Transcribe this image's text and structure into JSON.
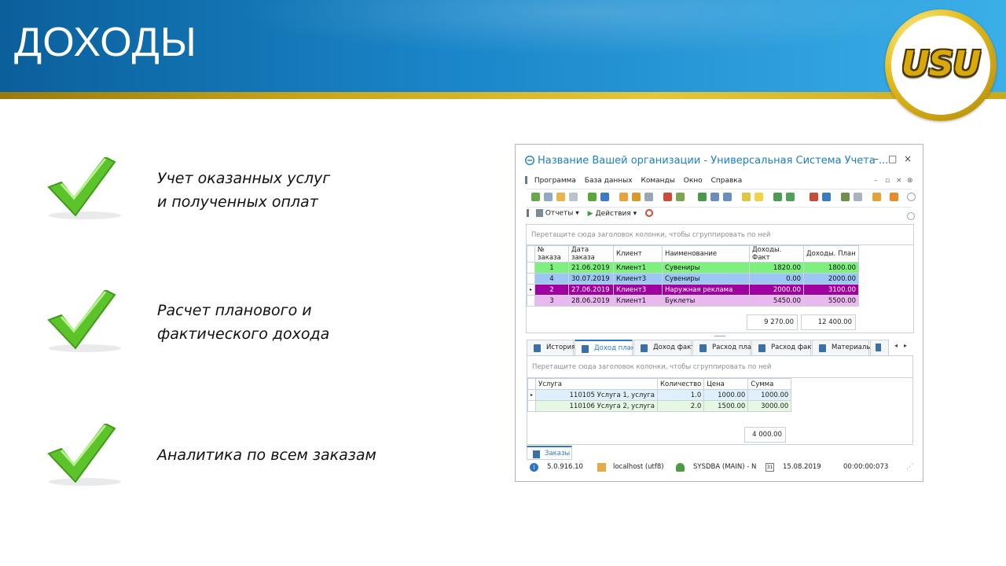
{
  "slide": {
    "title": "ДОХОДЫ",
    "logo_text": "USU",
    "colors": {
      "header_blue": "#1a86c9",
      "gold": "#c7a41c",
      "check_green": "#5cc42a"
    }
  },
  "features": [
    {
      "icon": "checkmark-icon",
      "lines": [
        "Учет оказанных услуг",
        "и полученных оплат"
      ]
    },
    {
      "icon": "checkmark-icon",
      "lines": [
        "Расчет планового и",
        "фактического дохода"
      ]
    },
    {
      "icon": "checkmark-icon",
      "lines": [
        "Аналитика по всем заказам"
      ]
    }
  ],
  "app": {
    "title": "Название Вашей организации - Универсальная Система Учета ...",
    "window_buttons": {
      "minimize": "–",
      "restore": "□",
      "close": "×"
    },
    "menu": [
      "Программа",
      "База данных",
      "Команды",
      "Окно",
      "Справка"
    ],
    "toolbar2": {
      "reports": "Отчеты ▾",
      "actions": "Действия ▾"
    },
    "orders_grid": {
      "group_hint": "Перетащите сюда заголовок колонки, чтобы сгруппировать по ней",
      "columns": [
        "№ заказа",
        "Дата заказа",
        "Клиент",
        "Наименование",
        "Доходы. Факт",
        "Доходы. План"
      ],
      "rows": [
        {
          "no": "1",
          "date": "21.06.2019",
          "client": "Клиент1",
          "name": "Сувениры",
          "fact": "1820.00",
          "plan": "1800.00",
          "color": "#7ef07e",
          "text": "#111111"
        },
        {
          "no": "4",
          "date": "30.07.2019",
          "client": "Клиент3",
          "name": "Сувениры",
          "fact": "0.00",
          "plan": "2000.00",
          "color": "#9cc6f4",
          "text": "#111111"
        },
        {
          "no": "2",
          "date": "27.06.2019",
          "client": "Клиент3",
          "name": "Наружная реклама",
          "fact": "2000.00",
          "plan": "3100.00",
          "color": "#a000a0",
          "text": "#ffffff"
        },
        {
          "no": "3",
          "date": "28.06.2019",
          "client": "Клиент1",
          "name": "Буклеты",
          "fact": "5450.00",
          "plan": "5500.00",
          "color": "#e8b8ee",
          "text": "#111111"
        }
      ],
      "totals": {
        "fact": "9 270.00",
        "plan": "12 400.00"
      }
    },
    "tabs": [
      "История",
      "Доход план",
      "Доход факт",
      "Расход план",
      "Расход факт",
      "Материалы"
    ],
    "active_tab": "Доход план",
    "detail_grid": {
      "group_hint": "Перетащите сюда заголовок колонки, чтобы сгруппировать по ней",
      "columns": [
        "Услуга",
        "Количество",
        "Цена",
        "Сумма"
      ],
      "rows": [
        {
          "service": "110105 Услуга 1, услуга",
          "qty": "1.0",
          "price": "1000.00",
          "sum": "1000.00",
          "color": "#dff0fc"
        },
        {
          "service": "110106 Услуга 2, услуга",
          "qty": "2.0",
          "price": "1500.00",
          "sum": "3000.00",
          "color": "#e4f8e4"
        }
      ],
      "total": "4 000.00"
    },
    "bottom_tab": "Заказы",
    "status": {
      "version": "5.0.916.10",
      "server": "localhost (utf8)",
      "user": "SYSDBA (MAIN) - N",
      "date": "15.08.2019",
      "timer": "00:00:00:073"
    }
  }
}
